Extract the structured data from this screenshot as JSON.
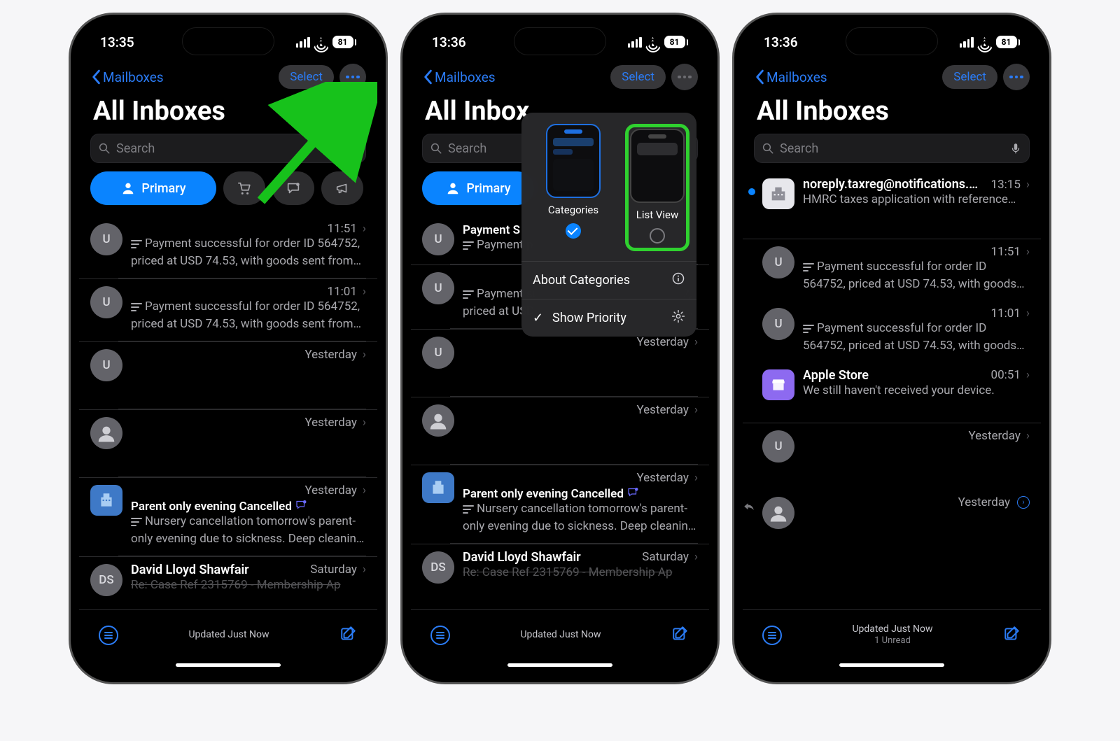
{
  "status": {
    "time_a": "13:35",
    "time_b": "13:36",
    "time_c": "13:36",
    "battery": "81"
  },
  "nav": {
    "back": "Mailboxes",
    "select": "Select"
  },
  "title": "All Inboxes",
  "search": {
    "placeholder": "Search"
  },
  "chips": {
    "primary": "Primary"
  },
  "phone1_rows": [
    {
      "avatar": "U",
      "time": "11:51",
      "preview": "Payment successful for order ID 564752, priced at USD 74.53, with goods sent from…",
      "summary": true
    },
    {
      "avatar": "U",
      "time": "11:01",
      "preview": "Payment successful for order ID 564752, priced at USD 74.53, with goods sent from…",
      "summary": true
    },
    {
      "avatar": "U",
      "time": "Yesterday"
    },
    {
      "avatar": "person",
      "time": "Yesterday"
    },
    {
      "avatar": "building",
      "time": "Yesterday",
      "subject": "Parent only evening Cancelled",
      "preview": "Nursery cancellation tomorrow's parent-only evening due to sickness. Deep cleanin…",
      "summary": true,
      "notif": true
    },
    {
      "avatar": "DS",
      "sender": "David Lloyd Shawfair",
      "time": "Saturday",
      "cut": true,
      "subject": "Re: Case Ref 2315769 - Membership Ap"
    }
  ],
  "phone2_rows": [
    {
      "avatar": "U",
      "subject": "Payment S",
      "preview": "Payment priced at U",
      "summary": true
    },
    {
      "avatar": "U",
      "preview": "Payment successful for order ID 564752, priced at USD 74.53, with goods sent from…",
      "summary": true
    },
    {
      "avatar": "U",
      "time": "Yesterday"
    },
    {
      "avatar": "person",
      "time": "Yesterday"
    },
    {
      "avatar": "building",
      "time": "Yesterday",
      "subject": "Parent only evening Cancelled",
      "preview": "Nursery cancellation tomorrow's parent-only evening due to sickness. Deep cleanin…",
      "summary": true,
      "notif": true
    },
    {
      "avatar": "DS",
      "sender": "David Lloyd Shawfair",
      "time": "Saturday",
      "cut": true,
      "subject": "Re: Case Ref 2315769 - Membership Ap"
    }
  ],
  "phone3_rows": [
    {
      "avatar": "building_white",
      "unread": true,
      "sender": "noreply.taxreg@notifications.…",
      "time": "13:15",
      "preview_single": "HMRC taxes application with reference 77V…"
    },
    {
      "avatar": "U",
      "time": "11:51",
      "preview": "Payment successful for order ID 564752, priced at USD 74.53, with goods sent from…",
      "summary": true
    },
    {
      "avatar": "U",
      "time": "11:01",
      "preview": "Payment successful for order ID 564752, priced at USD 74.53, with goods sent from…",
      "summary": true
    },
    {
      "avatar": "store",
      "sender": "Apple Store",
      "time": "00:51",
      "preview_single": "We still haven't received your device."
    },
    {
      "avatar": "U",
      "time": "Yesterday"
    },
    {
      "avatar": "person",
      "time": "Yesterday",
      "reply": true,
      "ring": true
    }
  ],
  "toolbar": {
    "updated": "Updated Just Now",
    "unread": "1 Unread"
  },
  "popover": {
    "opt1": "Categories",
    "opt2": "List View",
    "row1": "About Categories",
    "row2": "Show Priority"
  }
}
